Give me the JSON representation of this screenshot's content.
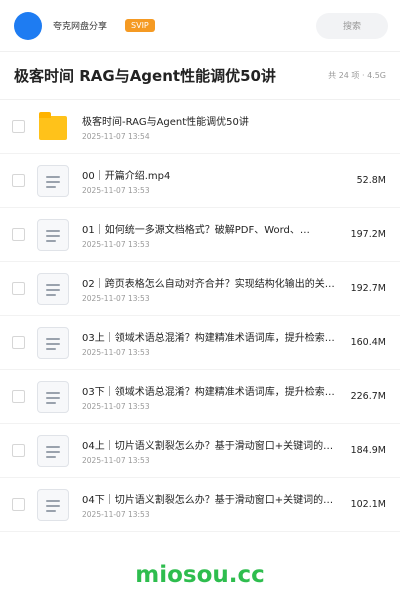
{
  "header": {
    "owner": "夸克网盘分享",
    "badge": "SVIP",
    "search_placeholder": "搜索",
    "avatar_color": "#1e7cf2"
  },
  "share": {
    "title": "极客时间 RAG与Agent性能调优50讲",
    "summary": "共 24 项 · 4.5G"
  },
  "files": [
    {
      "type": "folder-icon",
      "name": "极客时间-RAG与Agent性能调优50讲",
      "date": "2025-11-07 13:54",
      "size": ""
    },
    {
      "type": "document-icon",
      "name": "00｜开篇介绍.mp4",
      "date": "2025-11-07 13:53",
      "size": "52.8M"
    },
    {
      "type": "document-icon",
      "name": "01｜如何统一多源文档格式？破解PDF、Word、…",
      "date": "2025-11-07 13:53",
      "size": "197.2M"
    },
    {
      "type": "document-icon",
      "name": "02｜跨页表格怎么自动对齐合并？实现结构化输出的关…",
      "date": "2025-11-07 13:53",
      "size": "192.7M"
    },
    {
      "type": "document-icon",
      "name": "03上｜领域术语总混淆？构建精准术语词库，提升检索…",
      "date": "2025-11-07 13:53",
      "size": "160.4M"
    },
    {
      "type": "document-icon",
      "name": "03下｜领域术语总混淆？构建精准术语词库，提升检索…",
      "date": "2025-11-07 13:53",
      "size": "226.7M"
    },
    {
      "type": "document-icon",
      "name": "04上｜切片语义割裂怎么办？基于滑动窗口+关键词的…",
      "date": "2025-11-07 13:53",
      "size": "184.9M"
    },
    {
      "type": "document-icon",
      "name": "04下｜切片语义割裂怎么办？基于滑动窗口+关键词的…",
      "date": "2025-11-07 13:53",
      "size": "102.1M"
    }
  ],
  "watermark": "miosou.cc"
}
